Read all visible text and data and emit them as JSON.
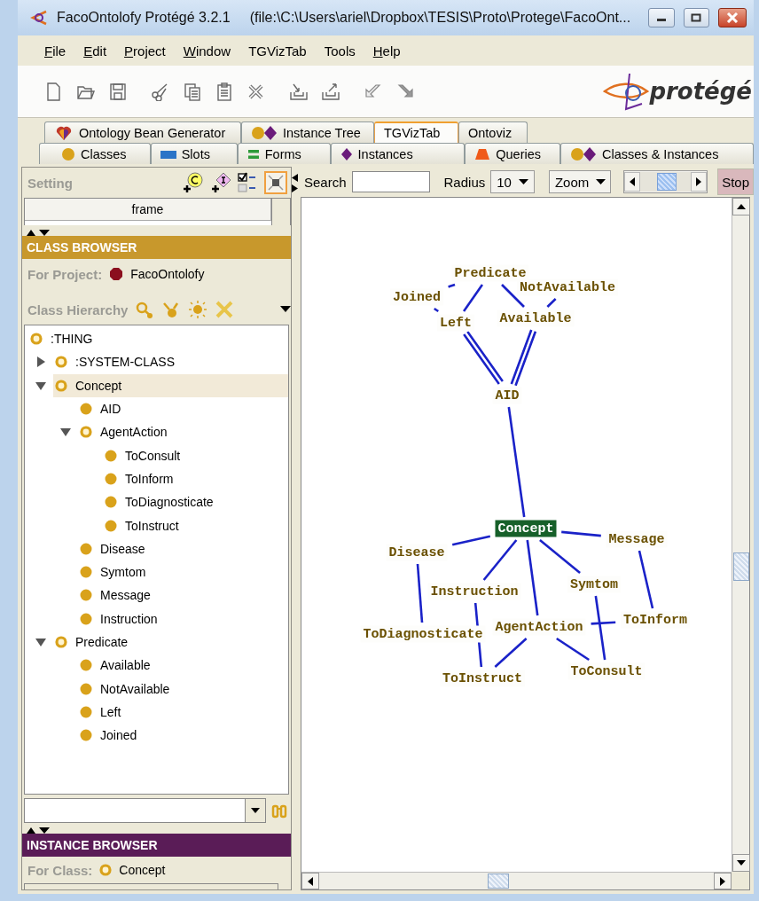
{
  "window": {
    "title": "FacoOntolofy  Protégé 3.2.1",
    "path": "(file:\\C:\\Users\\ariel\\Dropbox\\TESIS\\Proto\\Protege\\FacoOnt..."
  },
  "menu": [
    {
      "label": "File",
      "underlined": true
    },
    {
      "label": "Edit",
      "underlined": true
    },
    {
      "label": "Project",
      "underlined": true
    },
    {
      "label": "Window",
      "underlined": true
    },
    {
      "label": "TGVizTab",
      "underlined": false
    },
    {
      "label": "Tools",
      "underlined": false
    },
    {
      "label": "Help",
      "underlined": true
    }
  ],
  "logo": "protégé",
  "tabs_top": [
    {
      "label": "Ontology Bean Generator",
      "kind": "bean",
      "selected": false
    },
    {
      "label": "Instance Tree",
      "kind": "pair",
      "selected": false
    },
    {
      "label": "TGVizTab",
      "kind": "none",
      "selected": true
    },
    {
      "label": "Ontoviz",
      "kind": "none",
      "selected": false
    }
  ],
  "tabs_bottom": [
    {
      "label": "Classes",
      "kind": "class",
      "selected": false
    },
    {
      "label": "Slots",
      "kind": "slot",
      "selected": false
    },
    {
      "label": "Forms",
      "kind": "form",
      "selected": false
    },
    {
      "label": "Instances",
      "kind": "instance",
      "selected": false
    },
    {
      "label": "Queries",
      "kind": "query",
      "selected": false
    },
    {
      "label": "Classes & Instances",
      "kind": "pair",
      "selected": false
    }
  ],
  "settings_panel": {
    "title": "Setting",
    "column": "frame"
  },
  "class_browser": {
    "title": "CLASS BROWSER",
    "project_label": "For Project:",
    "project": "FacoOntolofy",
    "hierarchy_label": "Class Hierarchy",
    "tree": [
      {
        "label": ":THING",
        "kind": "abstract",
        "selected": false,
        "children": [
          {
            "label": ":SYSTEM-CLASS",
            "kind": "abstract",
            "selected": false,
            "expanded": false
          },
          {
            "label": "Concept",
            "kind": "abstract",
            "selected": true,
            "expanded": true,
            "children": [
              {
                "label": "AID",
                "kind": "concrete",
                "selected": false
              },
              {
                "label": "AgentAction",
                "kind": "abstract",
                "selected": false,
                "expanded": true,
                "children": [
                  {
                    "label": "ToConsult",
                    "kind": "concrete",
                    "selected": false
                  },
                  {
                    "label": "ToInform",
                    "kind": "concrete",
                    "selected": false
                  },
                  {
                    "label": "ToDiagnosticate",
                    "kind": "concrete",
                    "selected": false
                  },
                  {
                    "label": "ToInstruct",
                    "kind": "concrete",
                    "selected": false
                  }
                ]
              },
              {
                "label": "Disease",
                "kind": "concrete",
                "selected": false
              },
              {
                "label": "Symtom",
                "kind": "concrete",
                "selected": false
              },
              {
                "label": "Message",
                "kind": "concrete",
                "selected": false
              },
              {
                "label": "Instruction",
                "kind": "concrete",
                "selected": false
              }
            ]
          },
          {
            "label": "Predicate",
            "kind": "abstract",
            "selected": false,
            "expanded": true,
            "children": [
              {
                "label": "Available",
                "kind": "concrete",
                "selected": false
              },
              {
                "label": "NotAvailable",
                "kind": "concrete",
                "selected": false
              },
              {
                "label": "Left",
                "kind": "concrete",
                "selected": false
              },
              {
                "label": "Joined",
                "kind": "concrete",
                "selected": false
              }
            ]
          }
        ]
      }
    ]
  },
  "instance_browser": {
    "title": "INSTANCE BROWSER",
    "class_label": "For Class:",
    "class": "Concept"
  },
  "graph_toolbar": {
    "search_label": "Search",
    "radius_label": "Radius",
    "radius": "10",
    "zoom": "Zoom",
    "zoom_slider": {
      "level": 0.55
    },
    "stop": "Stop"
  },
  "graph": {
    "nodes": [
      {
        "label": "Predicate",
        "selected": false
      },
      {
        "label": "NotAvailable",
        "selected": false
      },
      {
        "label": "Joined",
        "selected": false
      },
      {
        "label": "Left",
        "selected": false
      },
      {
        "label": "Available",
        "selected": false
      },
      {
        "label": "AID",
        "selected": false
      },
      {
        "label": "Concept",
        "selected": true
      },
      {
        "label": "Disease",
        "selected": false
      },
      {
        "label": "Message",
        "selected": false
      },
      {
        "label": "Instruction",
        "selected": false
      },
      {
        "label": "Symtom",
        "selected": false
      },
      {
        "label": "ToDiagnosticate",
        "selected": false
      },
      {
        "label": "AgentAction",
        "selected": false
      },
      {
        "label": "ToInform",
        "selected": false
      },
      {
        "label": "ToInstruct",
        "selected": false
      },
      {
        "label": "ToConsult",
        "selected": false
      }
    ]
  }
}
